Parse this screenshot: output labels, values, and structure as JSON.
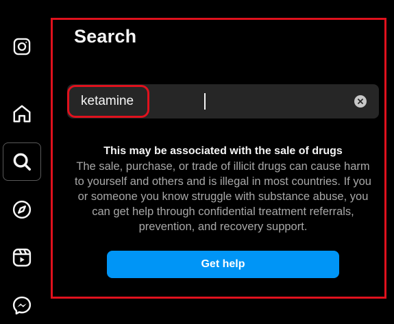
{
  "nav": {
    "items": [
      {
        "name": "instagram-logo-icon"
      },
      {
        "name": "home-icon"
      },
      {
        "name": "search-icon",
        "active": true
      },
      {
        "name": "explore-icon"
      },
      {
        "name": "reels-icon"
      },
      {
        "name": "messenger-icon"
      }
    ]
  },
  "search": {
    "title": "Search",
    "query": "ketamine",
    "clear_icon": "clear-icon"
  },
  "warning": {
    "title": "This may be associated with the sale of drugs",
    "body": "The sale, purchase, or trade of illicit drugs can cause harm to yourself and others and is illegal in most countries. If you or someone you know struggle with substance abuse, you can get help through confidential treatment referrals, prevention, and recovery support."
  },
  "actions": {
    "get_help_label": "Get help"
  },
  "colors": {
    "background": "#000000",
    "input_background": "#262626",
    "primary_button": "#0095f6",
    "highlight_red": "#e0111d",
    "secondary_text": "#a8a8a8"
  }
}
